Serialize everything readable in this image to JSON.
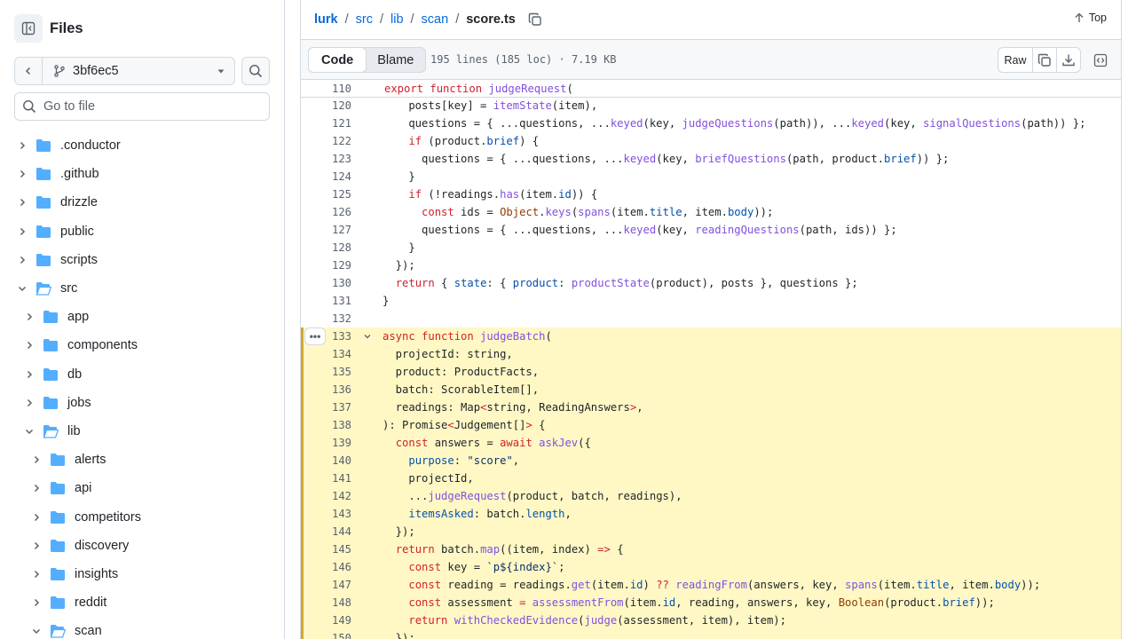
{
  "sidebar": {
    "title": "Files",
    "branch": "3bf6ec5",
    "search_placeholder": "Go to file",
    "tree": [
      {
        "name": ".conductor",
        "depth": 0,
        "open": false
      },
      {
        "name": ".github",
        "depth": 0,
        "open": false
      },
      {
        "name": "drizzle",
        "depth": 0,
        "open": false
      },
      {
        "name": "public",
        "depth": 0,
        "open": false
      },
      {
        "name": "scripts",
        "depth": 0,
        "open": false
      },
      {
        "name": "src",
        "depth": 0,
        "open": true
      },
      {
        "name": "app",
        "depth": 1,
        "open": false
      },
      {
        "name": "components",
        "depth": 1,
        "open": false
      },
      {
        "name": "db",
        "depth": 1,
        "open": false
      },
      {
        "name": "jobs",
        "depth": 1,
        "open": false
      },
      {
        "name": "lib",
        "depth": 1,
        "open": true
      },
      {
        "name": "alerts",
        "depth": 2,
        "open": false
      },
      {
        "name": "api",
        "depth": 2,
        "open": false
      },
      {
        "name": "competitors",
        "depth": 2,
        "open": false
      },
      {
        "name": "discovery",
        "depth": 2,
        "open": false
      },
      {
        "name": "insights",
        "depth": 2,
        "open": false
      },
      {
        "name": "reddit",
        "depth": 2,
        "open": false
      },
      {
        "name": "scan",
        "depth": 2,
        "open": true
      }
    ]
  },
  "header": {
    "breadcrumb": [
      "lurk",
      "src",
      "lib",
      "scan"
    ],
    "file": "score.ts",
    "top_label": "Top"
  },
  "toolbar": {
    "code_tab": "Code",
    "blame_tab": "Blame",
    "file_info": "195 lines (185 loc) · 7.19 KB",
    "raw_label": "Raw"
  },
  "colors": {
    "keyword": "#cf222e",
    "function": "#8250df",
    "property": "#0550ae",
    "string": "#0a3069",
    "constant": "#953800",
    "highlight": "#fff8c5"
  },
  "sticky": {
    "num": "110",
    "tokens": [
      [
        "export ",
        "k"
      ],
      [
        "function ",
        "k"
      ],
      [
        "judgeRequest",
        "f"
      ],
      [
        "(",
        ""
      ]
    ]
  },
  "code": [
    {
      "num": "120",
      "tokens": [
        [
          "    posts[key] = ",
          ""
        ],
        [
          "itemState",
          "f"
        ],
        [
          "(item),",
          ""
        ]
      ]
    },
    {
      "num": "121",
      "tokens": [
        [
          "    questions = { ...questions, ...",
          ""
        ],
        [
          "keyed",
          "f"
        ],
        [
          "(key, ",
          ""
        ],
        [
          "judgeQuestions",
          "f"
        ],
        [
          "(path)), ...",
          ""
        ],
        [
          "keyed",
          "f"
        ],
        [
          "(key, ",
          ""
        ],
        [
          "signalQuestions",
          "f"
        ],
        [
          "(path)) };",
          ""
        ]
      ]
    },
    {
      "num": "122",
      "tokens": [
        [
          "    ",
          ""
        ],
        [
          "if",
          "k"
        ],
        [
          " (product.",
          ""
        ],
        [
          "brief",
          "p"
        ],
        [
          ") {",
          ""
        ]
      ]
    },
    {
      "num": "123",
      "tokens": [
        [
          "      questions = { ...questions, ...",
          ""
        ],
        [
          "keyed",
          "f"
        ],
        [
          "(key, ",
          ""
        ],
        [
          "briefQuestions",
          "f"
        ],
        [
          "(path, product.",
          ""
        ],
        [
          "brief",
          "p"
        ],
        [
          ")) };",
          ""
        ]
      ]
    },
    {
      "num": "124",
      "tokens": [
        [
          "    }",
          ""
        ]
      ]
    },
    {
      "num": "125",
      "tokens": [
        [
          "    ",
          ""
        ],
        [
          "if",
          "k"
        ],
        [
          " (!readings.",
          ""
        ],
        [
          "has",
          "f"
        ],
        [
          "(item.",
          ""
        ],
        [
          "id",
          "p"
        ],
        [
          ")) {",
          ""
        ]
      ]
    },
    {
      "num": "126",
      "tokens": [
        [
          "      ",
          ""
        ],
        [
          "const",
          "k"
        ],
        [
          " ids = ",
          ""
        ],
        [
          "Object",
          "c"
        ],
        [
          ".",
          ""
        ],
        [
          "keys",
          "f"
        ],
        [
          "(",
          ""
        ],
        [
          "spans",
          "f"
        ],
        [
          "(item.",
          ""
        ],
        [
          "title",
          "p"
        ],
        [
          ", item.",
          ""
        ],
        [
          "body",
          "p"
        ],
        [
          "));",
          ""
        ]
      ]
    },
    {
      "num": "127",
      "tokens": [
        [
          "      questions = { ...questions, ...",
          ""
        ],
        [
          "keyed",
          "f"
        ],
        [
          "(key, ",
          ""
        ],
        [
          "readingQuestions",
          "f"
        ],
        [
          "(path, ids)) };",
          ""
        ]
      ]
    },
    {
      "num": "128",
      "tokens": [
        [
          "    }",
          ""
        ]
      ]
    },
    {
      "num": "129",
      "tokens": [
        [
          "  });",
          ""
        ]
      ]
    },
    {
      "num": "130",
      "tokens": [
        [
          "  ",
          ""
        ],
        [
          "return",
          "k"
        ],
        [
          " { ",
          ""
        ],
        [
          "state",
          "p"
        ],
        [
          ": { ",
          ""
        ],
        [
          "product",
          "p"
        ],
        [
          ": ",
          ""
        ],
        [
          "productState",
          "f"
        ],
        [
          "(product), posts }, questions };",
          ""
        ]
      ]
    },
    {
      "num": "131",
      "tokens": [
        [
          "}",
          ""
        ]
      ]
    },
    {
      "num": "132",
      "tokens": [
        [
          "",
          ""
        ]
      ]
    },
    {
      "num": "133",
      "hl": true,
      "fold": true,
      "tokens": [
        [
          "async ",
          "k"
        ],
        [
          "function ",
          "k"
        ],
        [
          "judgeBatch",
          "f"
        ],
        [
          "(",
          ""
        ]
      ]
    },
    {
      "num": "134",
      "hl": true,
      "tokens": [
        [
          "  projectId: string,",
          ""
        ]
      ]
    },
    {
      "num": "135",
      "hl": true,
      "tokens": [
        [
          "  product: ProductFacts,",
          ""
        ]
      ]
    },
    {
      "num": "136",
      "hl": true,
      "tokens": [
        [
          "  batch: ScorableItem[],",
          ""
        ]
      ]
    },
    {
      "num": "137",
      "hl": true,
      "tokens": [
        [
          "  readings: Map",
          ""
        ],
        [
          "<",
          "k"
        ],
        [
          "string, ReadingAnswers",
          ""
        ],
        [
          ">",
          "k"
        ],
        [
          ",",
          ""
        ]
      ]
    },
    {
      "num": "138",
      "hl": true,
      "tokens": [
        [
          "): Promise",
          ""
        ],
        [
          "<",
          "k"
        ],
        [
          "Judgement[]",
          ""
        ],
        [
          ">",
          "k"
        ],
        [
          " {",
          ""
        ]
      ]
    },
    {
      "num": "139",
      "hl": true,
      "tokens": [
        [
          "  ",
          ""
        ],
        [
          "const",
          "k"
        ],
        [
          " answers = ",
          ""
        ],
        [
          "await",
          "k"
        ],
        [
          " ",
          ""
        ],
        [
          "askJev",
          "f"
        ],
        [
          "({",
          ""
        ]
      ]
    },
    {
      "num": "140",
      "hl": true,
      "tokens": [
        [
          "    ",
          ""
        ],
        [
          "purpose",
          "p"
        ],
        [
          ": ",
          ""
        ],
        [
          "\"score\"",
          "s"
        ],
        [
          ",",
          ""
        ]
      ]
    },
    {
      "num": "141",
      "hl": true,
      "tokens": [
        [
          "    projectId,",
          ""
        ]
      ]
    },
    {
      "num": "142",
      "hl": true,
      "tokens": [
        [
          "    ...",
          ""
        ],
        [
          "judgeRequest",
          "f"
        ],
        [
          "(product, batch, readings),",
          ""
        ]
      ]
    },
    {
      "num": "143",
      "hl": true,
      "tokens": [
        [
          "    ",
          ""
        ],
        [
          "itemsAsked",
          "p"
        ],
        [
          ": batch.",
          ""
        ],
        [
          "length",
          "p"
        ],
        [
          ",",
          ""
        ]
      ]
    },
    {
      "num": "144",
      "hl": true,
      "tokens": [
        [
          "  });",
          ""
        ]
      ]
    },
    {
      "num": "145",
      "hl": true,
      "tokens": [
        [
          "  ",
          ""
        ],
        [
          "return",
          "k"
        ],
        [
          " batch.",
          ""
        ],
        [
          "map",
          "f"
        ],
        [
          "((item, index) ",
          ""
        ],
        [
          "=>",
          "k"
        ],
        [
          " {",
          ""
        ]
      ]
    },
    {
      "num": "146",
      "hl": true,
      "tokens": [
        [
          "    ",
          ""
        ],
        [
          "const",
          "k"
        ],
        [
          " key = ",
          ""
        ],
        [
          "`p${index}`",
          "s"
        ],
        [
          ";",
          ""
        ]
      ]
    },
    {
      "num": "147",
      "hl": true,
      "tokens": [
        [
          "    ",
          ""
        ],
        [
          "const",
          "k"
        ],
        [
          " reading = readings.",
          ""
        ],
        [
          "get",
          "f"
        ],
        [
          "(item.",
          ""
        ],
        [
          "id",
          "p"
        ],
        [
          ") ",
          ""
        ],
        [
          "??",
          "k"
        ],
        [
          " ",
          ""
        ],
        [
          "readingFrom",
          "f"
        ],
        [
          "(answers, key, ",
          ""
        ],
        [
          "spans",
          "f"
        ],
        [
          "(item.",
          ""
        ],
        [
          "title",
          "p"
        ],
        [
          ", item.",
          ""
        ],
        [
          "body",
          "p"
        ],
        [
          "));",
          ""
        ]
      ]
    },
    {
      "num": "148",
      "hl": true,
      "tokens": [
        [
          "    ",
          ""
        ],
        [
          "const",
          "k"
        ],
        [
          " assessment ",
          ""
        ],
        [
          "=",
          "k"
        ],
        [
          " ",
          ""
        ],
        [
          "assessmentFrom",
          "f"
        ],
        [
          "(item.",
          ""
        ],
        [
          "id",
          "p"
        ],
        [
          ", reading, answers, key, ",
          ""
        ],
        [
          "Boolean",
          "c"
        ],
        [
          "(product.",
          ""
        ],
        [
          "brief",
          "p"
        ],
        [
          "));",
          ""
        ]
      ]
    },
    {
      "num": "149",
      "hl": true,
      "tokens": [
        [
          "    ",
          ""
        ],
        [
          "return",
          "k"
        ],
        [
          " ",
          ""
        ],
        [
          "withCheckedEvidence",
          "f"
        ],
        [
          "(",
          ""
        ],
        [
          "judge",
          "f"
        ],
        [
          "(assessment, item), item);",
          ""
        ]
      ]
    },
    {
      "num": "150",
      "hl": true,
      "tokens": [
        [
          "  });",
          ""
        ]
      ]
    }
  ]
}
